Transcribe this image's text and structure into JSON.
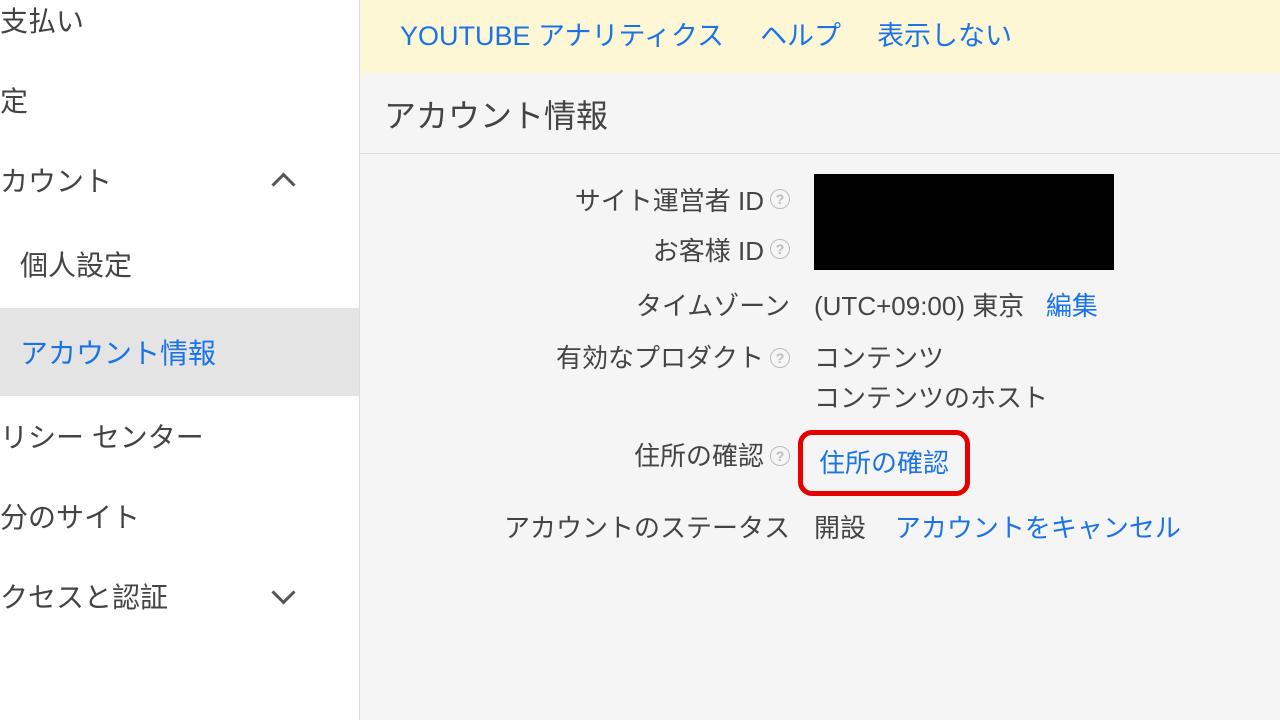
{
  "sidebar": {
    "items": [
      {
        "label": "支払い"
      },
      {
        "label": "定"
      },
      {
        "label": "カウント",
        "expanded": true
      },
      {
        "label": "リシー センター"
      },
      {
        "label": "分のサイト"
      },
      {
        "label": "クセスと認証",
        "expanded": false
      }
    ],
    "sub_items": [
      {
        "label": "個人設定",
        "active": false
      },
      {
        "label": "アカウント情報",
        "active": true
      }
    ]
  },
  "banner": {
    "analytics": "YOUTUBE アナリティクス",
    "help": "ヘルプ",
    "dismiss": "表示しない"
  },
  "page_title": "アカウント情報",
  "fields": {
    "publisher_id_label": "サイト運営者 ID",
    "customer_id_label": "お客様 ID",
    "timezone_label": "タイムゾーン",
    "timezone_value": "(UTC+09:00) 東京",
    "timezone_edit": "編集",
    "products_label": "有効なプロダクト",
    "products_value_1": "コンテンツ",
    "products_value_2": "コンテンツのホスト",
    "address_verify_label": "住所の確認",
    "address_verify_link": "住所の確認",
    "status_label": "アカウントのステータス",
    "status_value": "開設",
    "status_cancel": "アカウントをキャンセル"
  }
}
